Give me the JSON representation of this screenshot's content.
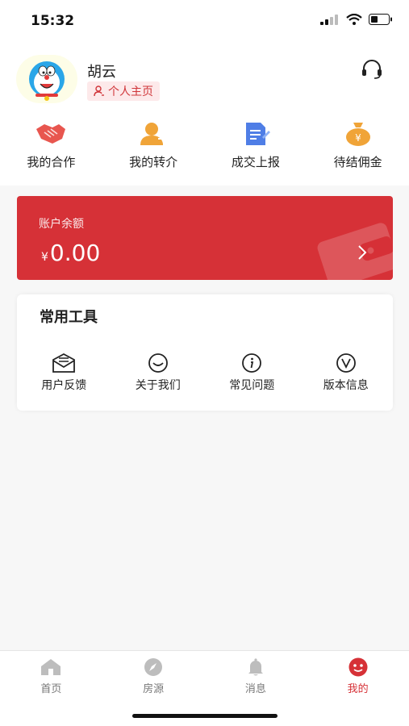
{
  "status_bar": {
    "time": "15:32"
  },
  "user": {
    "name": "胡云",
    "profile_button": "个人主页"
  },
  "quick_actions": [
    {
      "label": "我的合作",
      "icon": "handshake-icon"
    },
    {
      "label": "我的转介",
      "icon": "user-transfer-icon"
    },
    {
      "label": "成交上报",
      "icon": "report-icon"
    },
    {
      "label": "待结佣金",
      "icon": "money-bag-icon"
    }
  ],
  "balance": {
    "label": "账户余额",
    "currency": "¥",
    "amount": "0.00"
  },
  "tools": {
    "title": "常用工具",
    "items": [
      {
        "label": "用户反馈",
        "icon": "feedback-icon"
      },
      {
        "label": "关于我们",
        "icon": "smile-icon"
      },
      {
        "label": "常见问题",
        "icon": "info-icon"
      },
      {
        "label": "版本信息",
        "icon": "version-icon"
      }
    ]
  },
  "tabbar": {
    "items": [
      {
        "label": "首页",
        "icon": "home-icon",
        "active": false
      },
      {
        "label": "房源",
        "icon": "compass-icon",
        "active": false
      },
      {
        "label": "消息",
        "icon": "bell-icon",
        "active": false
      },
      {
        "label": "我的",
        "icon": "profile-face-icon",
        "active": true
      }
    ]
  },
  "colors": {
    "accent": "#d63137",
    "profile_badge_bg": "#fde9ea",
    "quick_red": "#e8564f",
    "quick_orange": "#f0a438",
    "quick_blue": "#4f7ee6"
  }
}
